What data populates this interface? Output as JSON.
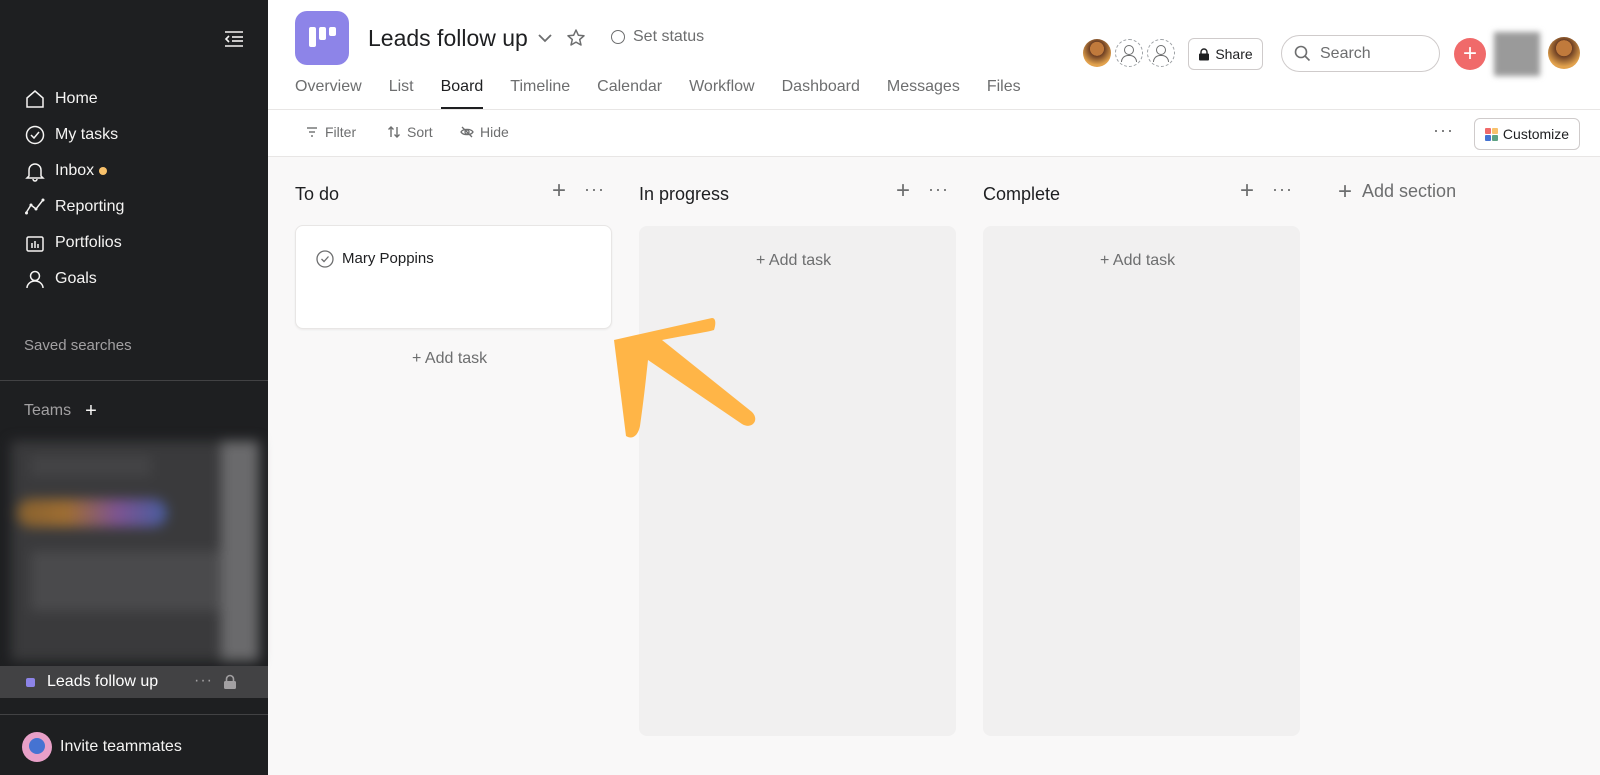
{
  "sidebar": {
    "nav": [
      {
        "label": "Home",
        "icon": "home-icon"
      },
      {
        "label": "My tasks",
        "icon": "check-circle-icon"
      },
      {
        "label": "Inbox",
        "icon": "bell-icon"
      },
      {
        "label": "Reporting",
        "icon": "trend-line-icon"
      },
      {
        "label": "Portfolios",
        "icon": "folder-icon"
      },
      {
        "label": "Goals",
        "icon": "person-icon"
      }
    ],
    "saved_searches": "Saved searches",
    "teams": "Teams",
    "project": "Leads follow up",
    "invite": "Invite teammates"
  },
  "header": {
    "title": "Leads follow up",
    "set_status": "Set status",
    "tabs": [
      "Overview",
      "List",
      "Board",
      "Timeline",
      "Calendar",
      "Workflow",
      "Dashboard",
      "Messages",
      "Files"
    ],
    "active_tab": "Board",
    "share": "Share",
    "search_placeholder": "Search"
  },
  "toolbar": {
    "filter": "Filter",
    "sort": "Sort",
    "hide": "Hide",
    "customize": "Customize"
  },
  "board": {
    "columns": [
      {
        "title": "To do",
        "tasks": [
          "Mary Poppins"
        ],
        "add_task": "+ Add task"
      },
      {
        "title": "In progress",
        "tasks": [],
        "add_task": "+ Add task"
      },
      {
        "title": "Complete",
        "tasks": [],
        "add_task": "+ Add task"
      }
    ],
    "add_section": "Add section"
  },
  "colors": {
    "sidebar_bg": "#1e1f21",
    "project_color": "#8d84e8",
    "accent_plus": "#f06a6a",
    "inbox_dot": "#f8c16b",
    "arrow": "#ffb547"
  }
}
